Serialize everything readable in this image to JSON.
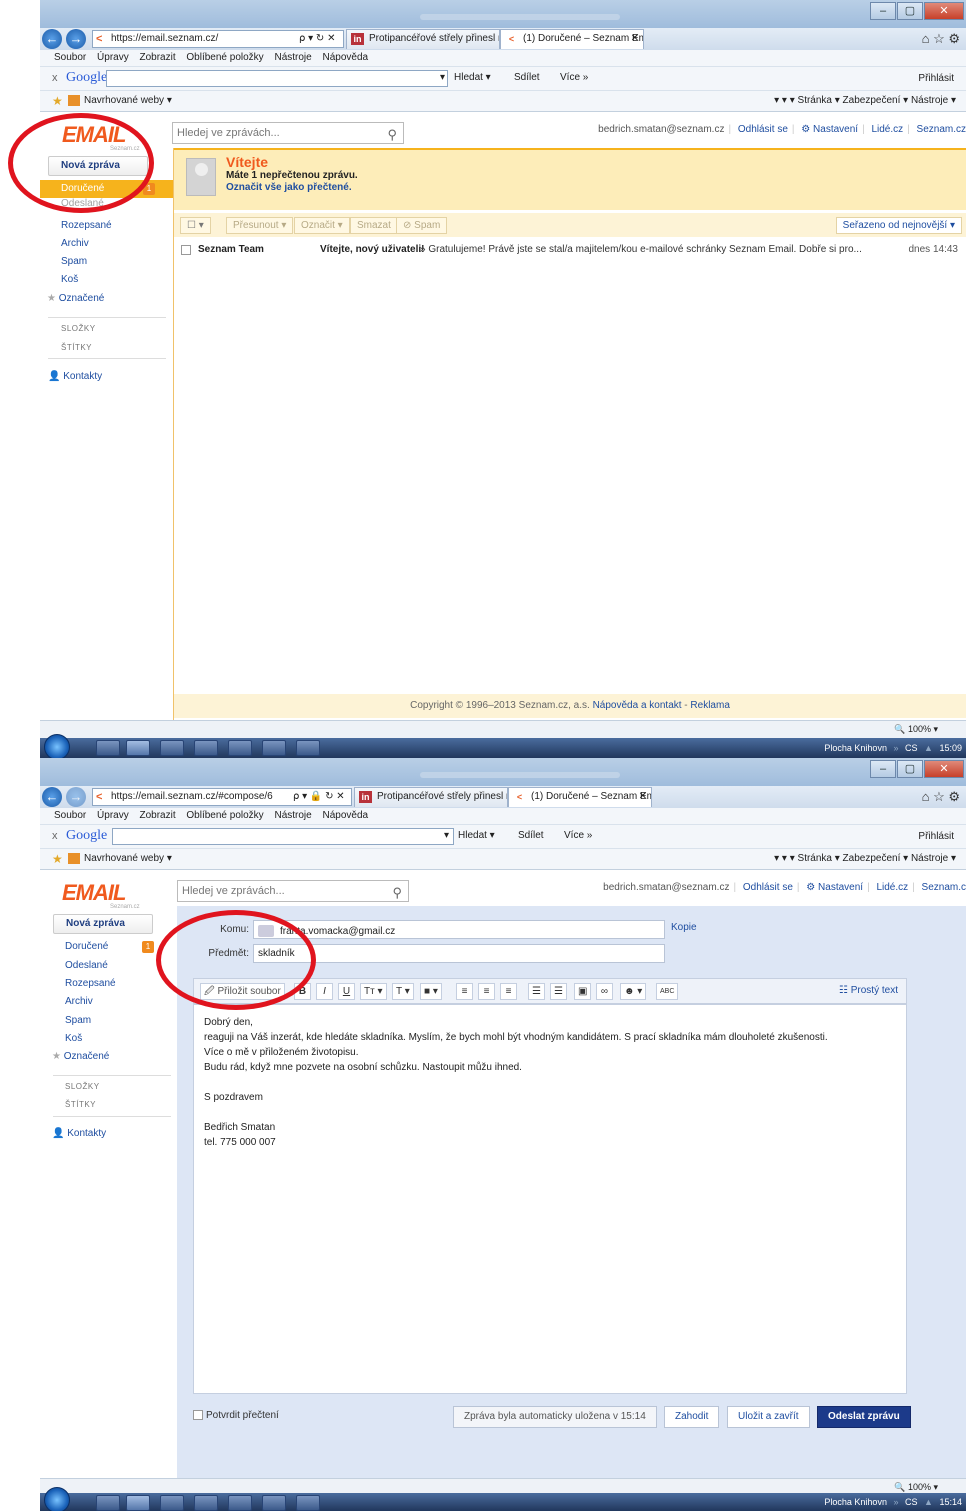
{
  "browser": {
    "url1": "https://email.seznam.cz/",
    "url2": "https://email.seznam.cz/#compose/6",
    "addr_controls1": "⍴ ▾ ↻ ✕",
    "addr_controls2": "⍴ ▾ 🔒 ↻ ✕",
    "tab1": "Protipancéřové střely přinesl n...",
    "tab2": "(1) Doručené – Seznam Email",
    "tab2_close": "✕",
    "menu": [
      "Soubor",
      "Úpravy",
      "Zobrazit",
      "Oblíbené položky",
      "Nástroje",
      "Nápověda"
    ],
    "google": {
      "logo": "Google",
      "close": "x",
      "hledat": "Hledat ▾",
      "sdilet": "Sdílet",
      "vice": "Více »",
      "prihlasit": "Přihlásit"
    },
    "favorites": {
      "suggested": "Navrhované weby ▾"
    },
    "command_bar": "▾ ▾ ▾ Stránka ▾ Zabezpečení ▾ Nástroje ▾",
    "status_zoom": "100%"
  },
  "email": {
    "search_placeholder": "Hledej ve zprávách...",
    "user1": "bedrich.smatan@seznam.cz",
    "user2": "bedrich.smatan@seznam.cz",
    "logout": "Odhlásit se",
    "settings": "Nastavení",
    "lide": "Lidé.cz",
    "seznam1": "Seznam.cz",
    "seznam2": "Seznam.c",
    "logo_text": "EMAIL",
    "logo_sub": "Seznam.cz",
    "new_message": "Nová zpráva",
    "folders": {
      "inbox": "Doručené",
      "sent": "Odeslané",
      "drafts": "Rozepsané",
      "archive": "Archiv",
      "spam": "Spam",
      "trash": "Koš",
      "starred": "Označené"
    },
    "inbox_badge": "1",
    "section_folders": "SLOŽKY",
    "section_tags": "ŠTÍTKY",
    "contacts": "Kontakty",
    "welcome": {
      "title": "Vítejte",
      "unread": "Máte 1 nepřečtenou zprávu.",
      "mark_all": "Označit vše jako přečtené."
    },
    "toolbar": {
      "move": "Přesunout ▾",
      "mark": "Označit ▾",
      "delete": "Smazat",
      "spam": "Spam",
      "sort": "Seřazeno od nejnovější ▾"
    },
    "messages": [
      {
        "from": "Seznam Team",
        "subject": "Vítejte, nový uživateli!",
        "snippet": "» Gratulujeme! Právě jste se stal/a majitelem/kou e-mailové schránky Seznam Email. Dobře si pro...",
        "date": "dnes 14:43"
      }
    ],
    "footer": {
      "copyright": "Copyright © 1996–2013 Seznam.cz, a.s.",
      "help": "Nápověda a kontakt",
      "ads": "Reklama"
    }
  },
  "compose": {
    "to_label": "Komu:",
    "to_value": "franta.vomacka@gmail.cz",
    "cc_link": "Kopie",
    "subject_label": "Předmět:",
    "subject_value": "skladník",
    "attach": "Přiložit soubor",
    "plain_text": "Prostý text",
    "body": [
      "Dobrý den,",
      "reaguji na Váš inzerát, kde hledáte skladníka. Myslím, že bych mohl být vhodným kandidátem. S prací skladníka mám dlouholeté zkušenosti.",
      "Více o mě v přiloženém životopisu.",
      "Budu rád, když mne pozvete na osobní schůzku. Nastoupit můžu ihned.",
      "",
      "S pozdravem",
      "",
      "Bedřich Smatan",
      "tel. 775 000 007"
    ],
    "confirm_read": "Potvrdit přečtení",
    "autosave": "Zpráva byla automaticky uložena v 15:14",
    "discard": "Zahodit",
    "save_close": "Uložit a zavřít",
    "send": "Odeslat zprávu"
  },
  "taskbar": {
    "desktop": "Plocha",
    "library": "Knihovn",
    "lang": "CS",
    "time1": "15:09",
    "time2": "15:14"
  },
  "colors": {
    "accent_orange": "#f05a1e",
    "selected_folder": "#f6b31c",
    "link_blue": "#1f4ea0",
    "annotation_red": "#e0141e",
    "send_button": "#1c3a8a"
  }
}
